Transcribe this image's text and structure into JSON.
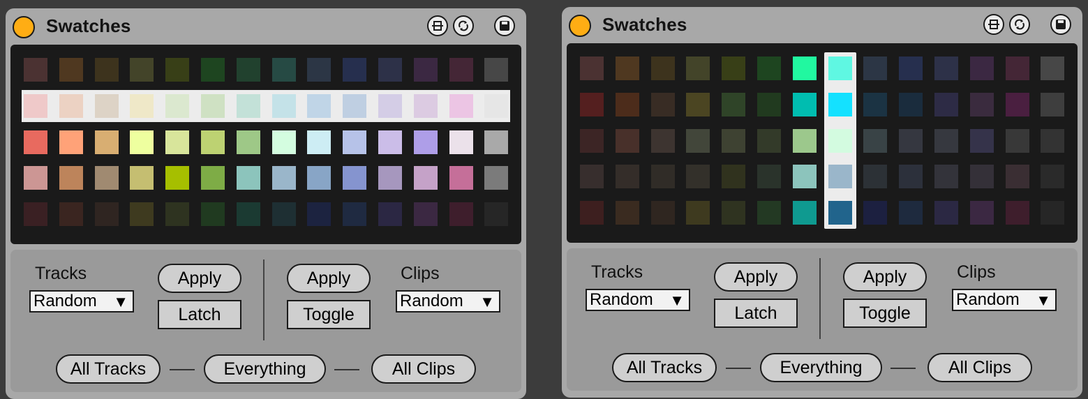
{
  "devices": [
    {
      "title": "Swatches",
      "icons": [
        "resize-icon",
        "sync-icon",
        "save-icon"
      ],
      "grid": [
        [
          "#4b3232",
          "#4f3820",
          "#3d331d",
          "#434429",
          "#383f17",
          "#1e4520",
          "#21412e",
          "#264a44",
          "#2c3645",
          "#262f4e",
          "#2d3148",
          "#3b2842",
          "#442636",
          "#474747"
        ],
        [
          "#efc9c9",
          "#ecd2c3",
          "#ddd3c6",
          "#efe8c8",
          "#dbe8cf",
          "#cfe1c3",
          "#c3e1d8",
          "#c4e2e8",
          "#c0d5e7",
          "#bfcfe2",
          "#d4cde6",
          "#dccbe2",
          "#ecc5e4",
          "#e6e6e6"
        ],
        [
          "#e86a5f",
          "#ffa278",
          "#d8ae72",
          "#eeff9f",
          "#d8e59b",
          "#bdd272",
          "#9ec887",
          "#d4fde0",
          "#cdedf4",
          "#b6c2e8",
          "#cbbde8",
          "#ae9ee8",
          "#ebe1ea",
          "#a9a9a9"
        ],
        [
          "#cc9694",
          "#bd845b",
          "#a08a71",
          "#c5be71",
          "#a6bf00",
          "#7eac46",
          "#8cc4bc",
          "#9ab6ca",
          "#88a5c6",
          "#8594cf",
          "#a697be",
          "#c5a2c8",
          "#c56f99",
          "#7b7b7b"
        ],
        [
          "#3a2023",
          "#3a2520",
          "#2f2521",
          "#3e3a1f",
          "#2e3320",
          "#203a20",
          "#1b3a32",
          "#1e2f33",
          "#1c2340",
          "#1f2a41",
          "#2b2743",
          "#3b2842",
          "#3e1e2c",
          "#262626"
        ]
      ],
      "selected_row": 2,
      "tracks": {
        "label": "Tracks",
        "mode": "Random",
        "apply": "Apply",
        "latch": "Latch"
      },
      "clips": {
        "label": "Clips",
        "mode": "Random",
        "apply": "Apply",
        "toggle": "Toggle"
      },
      "bottom": {
        "all_tracks": "All Tracks",
        "everything": "Everything",
        "all_clips": "All Clips"
      }
    },
    {
      "title": "Swatches",
      "icons": [
        "resize-icon",
        "sync-icon",
        "save-icon"
      ],
      "grid": [
        [
          "#4b3232",
          "#4f3820",
          "#3d331d",
          "#434429",
          "#383f17",
          "#1e4520",
          "#21f8a0",
          "#5ff7e2",
          "#2c3645",
          "#262f4e",
          "#2d3148",
          "#3b2842",
          "#442636",
          "#474747"
        ],
        [
          "#541f1f",
          "#4c2c1b",
          "#382c24",
          "#4b4522",
          "#2f4428",
          "#213a1f",
          "#00bdb0",
          "#14e1ff",
          "#1b3343",
          "#1a2c3d",
          "#2d2b45",
          "#3a2b3e",
          "#4a1f40",
          "#3e3e3e"
        ],
        [
          "#3c2525",
          "#48302a",
          "#3d3430",
          "#42463a",
          "#3e4232",
          "#333a29",
          "#9cc88c",
          "#d3fbe0",
          "#394346",
          "#353740",
          "#36383f",
          "#35334a",
          "#383838",
          "#333333"
        ],
        [
          "#372e2d",
          "#342d29",
          "#302c27",
          "#33302a",
          "#30321e",
          "#2a332b",
          "#8cc4bc",
          "#9ab6ca",
          "#2c3136",
          "#2c303b",
          "#33333a",
          "#343038",
          "#3a2e33",
          "#2a2a2a"
        ],
        [
          "#3d1f1f",
          "#3a2b20",
          "#2f2620",
          "#3e3a1f",
          "#2f3320",
          "#233923",
          "#0f9a90",
          "#21648c",
          "#1c2040",
          "#1e2a3e",
          "#2b2843",
          "#3b2842",
          "#3e1e2c",
          "#262626"
        ]
      ],
      "selected_col": 7,
      "tracks": {
        "label": "Tracks",
        "mode": "Random",
        "apply": "Apply",
        "latch": "Latch"
      },
      "clips": {
        "label": "Clips",
        "mode": "Random",
        "apply": "Apply",
        "toggle": "Toggle"
      },
      "bottom": {
        "all_tracks": "All Tracks",
        "everything": "Everything",
        "all_clips": "All Clips"
      }
    }
  ],
  "accent": "#ffad14"
}
